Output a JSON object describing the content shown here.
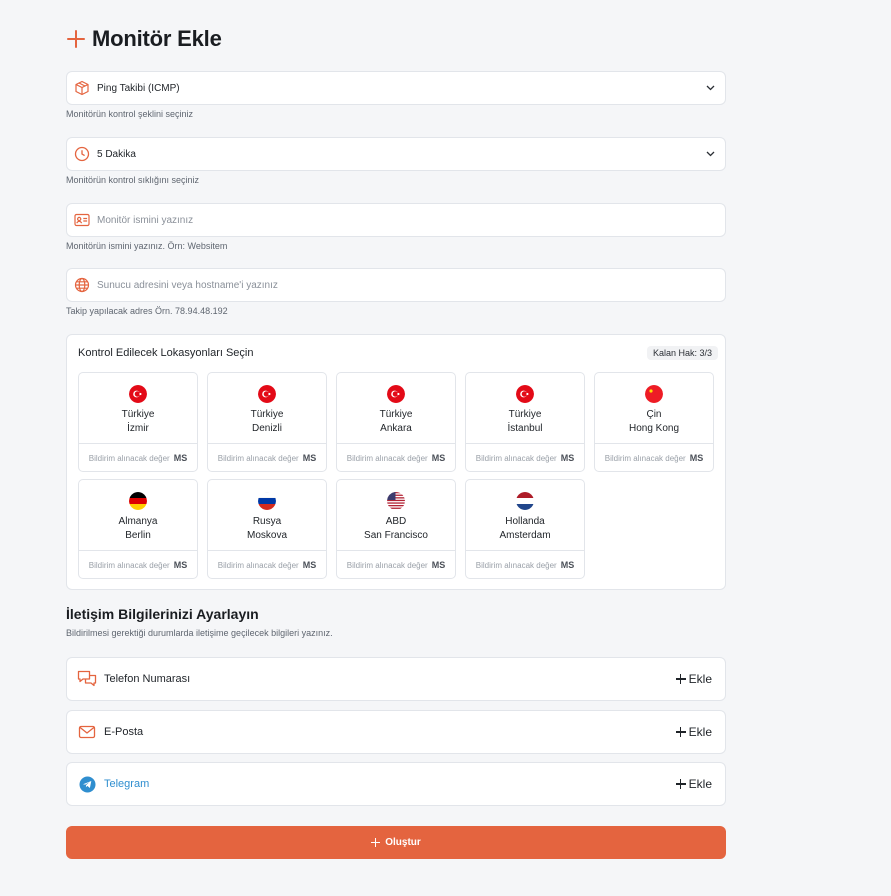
{
  "page": {
    "title": "Monitör Ekle"
  },
  "form": {
    "check_type": {
      "value": "Ping Takibi (ICMP)",
      "help": "Monitörün kontrol şeklini seçiniz",
      "icon": "box-icon"
    },
    "interval": {
      "value": "5 Dakika",
      "help": "Monitörün kontrol sıklığını seçiniz",
      "icon": "clock-icon"
    },
    "name": {
      "placeholder": "Monitör ismini yazınız",
      "value": "",
      "help": "Monitörün ismini yazınız. Örn: Websitem",
      "icon": "id-card-icon"
    },
    "host": {
      "placeholder": "Sunucu adresini veya hostname'i yazınız",
      "value": "",
      "help": "Takip yapılacak adres Örn. 78.94.48.192",
      "icon": "globe-icon"
    }
  },
  "locations": {
    "title": "Kontrol Edilecek Lokasyonları Seçin",
    "quota": "Kalan Hak: 3/3",
    "notify_placeholder": "Bildirim alınacak değer",
    "unit": "MS",
    "items": [
      {
        "country": "Türkiye",
        "city": "İzmir",
        "flag": "tr"
      },
      {
        "country": "Türkiye",
        "city": "Denizli",
        "flag": "tr"
      },
      {
        "country": "Türkiye",
        "city": "Ankara",
        "flag": "tr"
      },
      {
        "country": "Türkiye",
        "city": "İstanbul",
        "flag": "tr"
      },
      {
        "country": "Çin",
        "city": "Hong Kong",
        "flag": "cn"
      },
      {
        "country": "Almanya",
        "city": "Berlin",
        "flag": "de"
      },
      {
        "country": "Rusya",
        "city": "Moskova",
        "flag": "ru"
      },
      {
        "country": "ABD",
        "city": "San Francisco",
        "flag": "us"
      },
      {
        "country": "Hollanda",
        "city": "Amsterdam",
        "flag": "nl"
      }
    ]
  },
  "contact": {
    "title": "İletişim Bilgilerinizi Ayarlayın",
    "subtitle": "Bildirilmesi gerektiği durumlarda iletişime geçilecek bilgileri yazınız.",
    "add_label": "Ekle",
    "items": [
      {
        "label": "Telefon Numarası",
        "icon": "chat-bubbles-icon"
      },
      {
        "label": "E-Posta",
        "icon": "envelope-icon"
      },
      {
        "label": "Telegram",
        "icon": "telegram-icon"
      }
    ]
  },
  "submit_label": "Oluştur",
  "colors": {
    "accent": "#e4643f",
    "telegram": "#2f8ecf",
    "background": "#f5f6f8",
    "border": "#e2e5ea"
  }
}
